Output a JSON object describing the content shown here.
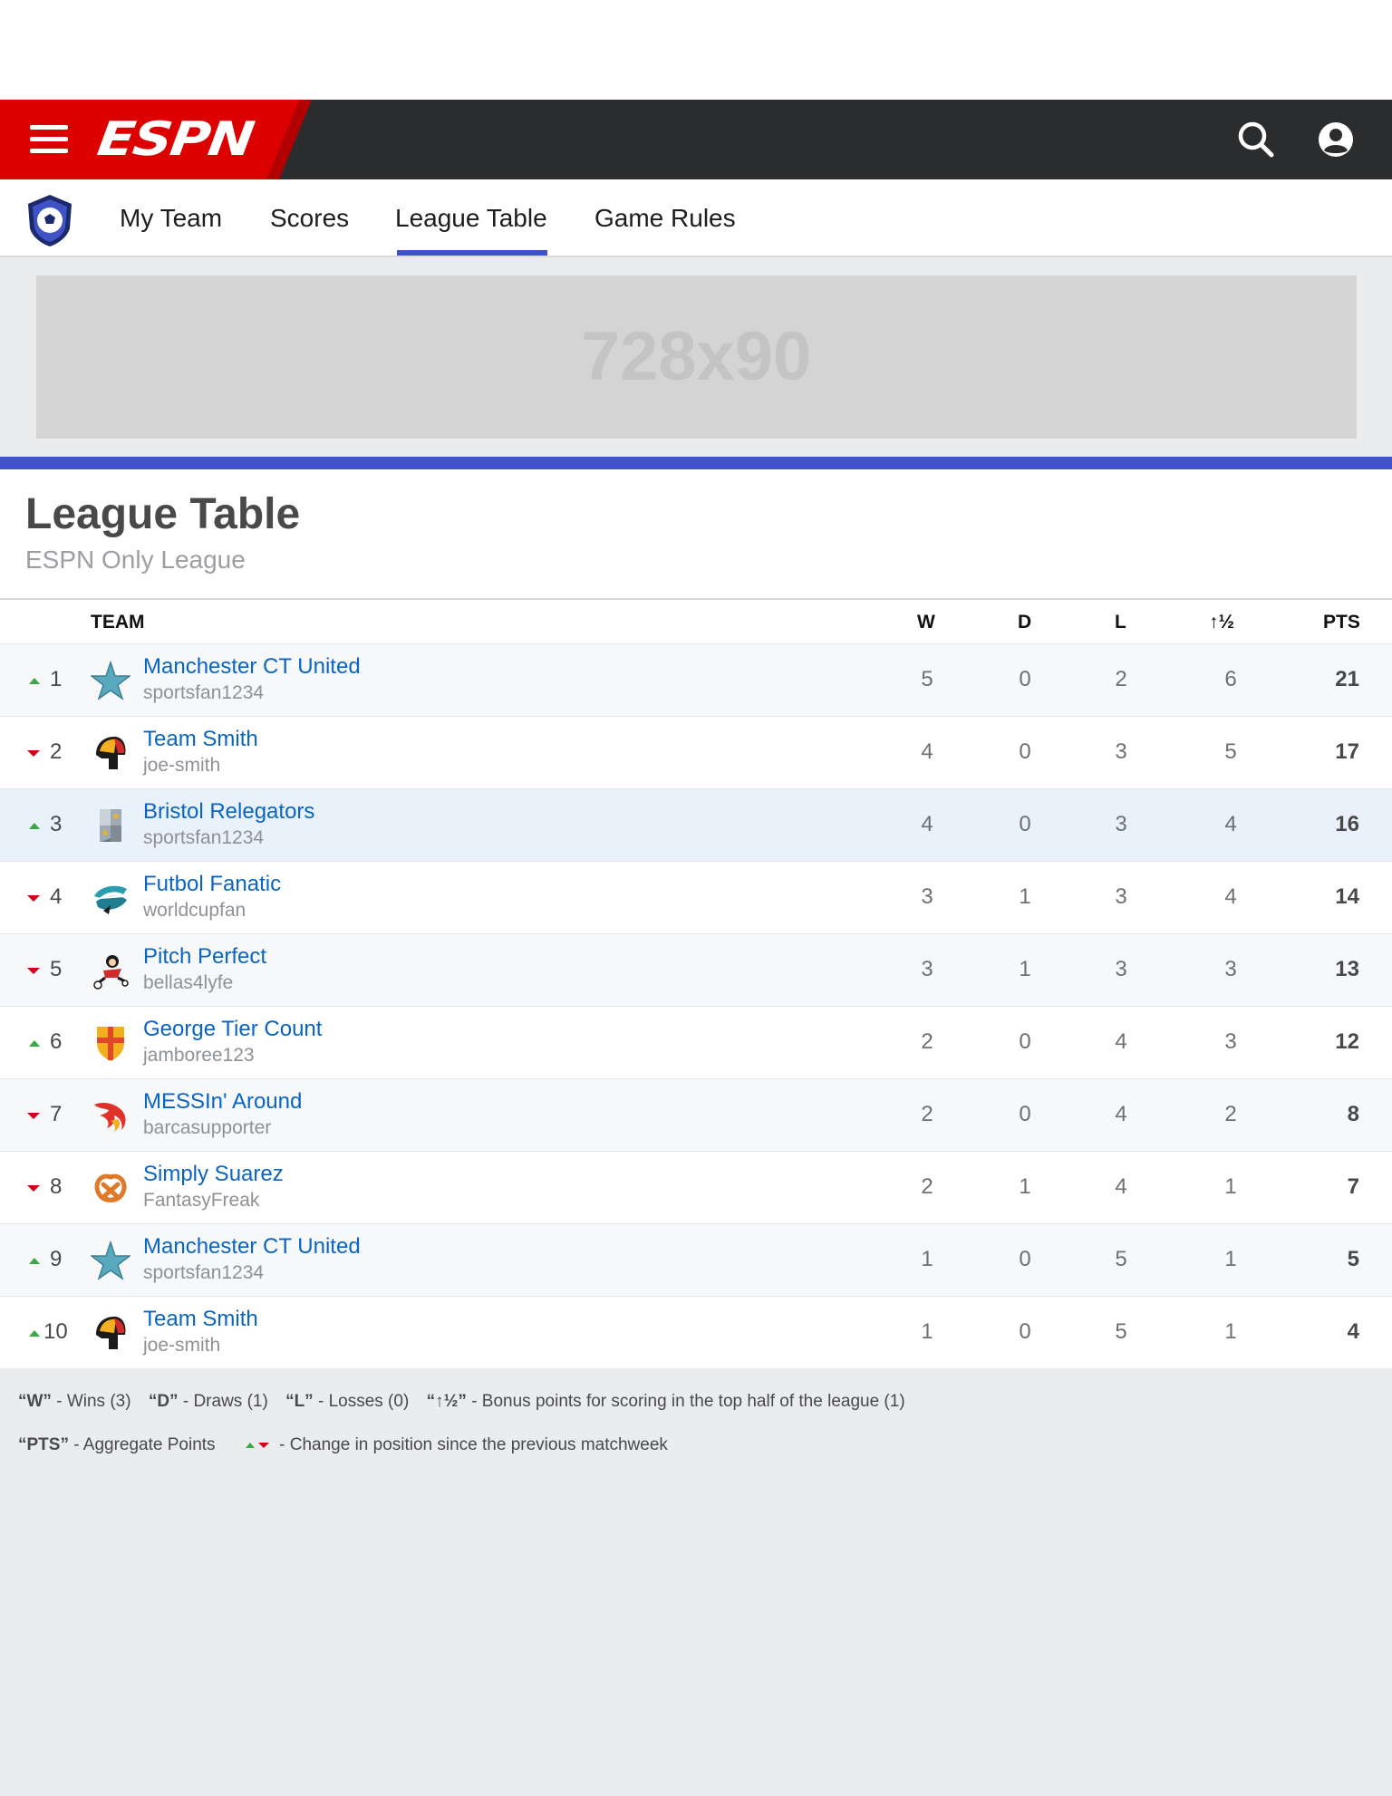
{
  "brand": {
    "name": "ESPN",
    "colors": {
      "red": "#dd0000",
      "dark_bar": "#2b2c2d",
      "accent_blue": "#3f53c7",
      "link_blue": "#0a64c1",
      "up_green": "#3da544",
      "down_red": "#d0021b"
    }
  },
  "header": {
    "menu_icon": "hamburger-menu-icon",
    "search_icon": "search-icon",
    "user_icon": "user-account-icon"
  },
  "subnav": {
    "badge_icon": "soccer-ball-shield-icon",
    "tabs": [
      {
        "label": "My Team",
        "active": false
      },
      {
        "label": "Scores",
        "active": false
      },
      {
        "label": "League Table",
        "active": true
      },
      {
        "label": "Game Rules",
        "active": false
      }
    ]
  },
  "ad": {
    "label": "728x90"
  },
  "page": {
    "title": "League Table",
    "subtitle": "ESPN Only League"
  },
  "table": {
    "columns": {
      "team": "TEAM",
      "w": "W",
      "d": "D",
      "l": "L",
      "bonus": "↑½",
      "pts": "PTS"
    },
    "rows": [
      {
        "rank": "1",
        "trend": "up",
        "logo": "star-logo-icon",
        "team": "Manchester CT United",
        "owner": "sportsfan1234",
        "w": "5",
        "d": "0",
        "l": "2",
        "bonus": "6",
        "pts": "21"
      },
      {
        "rank": "2",
        "trend": "down",
        "logo": "spartan-helmet-logo-icon",
        "team": "Team Smith",
        "owner": "joe-smith",
        "w": "4",
        "d": "0",
        "l": "3",
        "bonus": "5",
        "pts": "17"
      },
      {
        "rank": "3",
        "trend": "up",
        "logo": "crest-logo-icon",
        "team": "Bristol Relegators",
        "owner": "sportsfan1234",
        "w": "4",
        "d": "0",
        "l": "3",
        "bonus": "4",
        "pts": "16"
      },
      {
        "rank": "4",
        "trend": "down",
        "logo": "dolphin-logo-icon",
        "team": "Futbol Fanatic",
        "owner": "worldcupfan",
        "w": "3",
        "d": "1",
        "l": "3",
        "bonus": "4",
        "pts": "14"
      },
      {
        "rank": "5",
        "trend": "down",
        "logo": "cartoon-kicker-logo-icon",
        "team": "Pitch Perfect",
        "owner": "bellas4lyfe",
        "w": "3",
        "d": "1",
        "l": "3",
        "bonus": "3",
        "pts": "13"
      },
      {
        "rank": "6",
        "trend": "up",
        "logo": "cross-shield-logo-icon",
        "team": "George Tier Count",
        "owner": "jamboree123",
        "w": "2",
        "d": "0",
        "l": "4",
        "bonus": "3",
        "pts": "12"
      },
      {
        "rank": "7",
        "trend": "down",
        "logo": "phoenix-logo-icon",
        "team": "MESSIn' Around",
        "owner": "barcasupporter",
        "w": "2",
        "d": "0",
        "l": "4",
        "bonus": "2",
        "pts": "8"
      },
      {
        "rank": "8",
        "trend": "down",
        "logo": "pretzel-logo-icon",
        "team": "Simply Suarez",
        "owner": "FantasyFreak",
        "w": "2",
        "d": "1",
        "l": "4",
        "bonus": "1",
        "pts": "7"
      },
      {
        "rank": "9",
        "trend": "up",
        "logo": "star-logo-icon",
        "team": "Manchester CT United",
        "owner": "sportsfan1234",
        "w": "1",
        "d": "0",
        "l": "5",
        "bonus": "1",
        "pts": "5"
      },
      {
        "rank": "10",
        "trend": "up",
        "logo": "spartan-helmet-logo-icon",
        "team": "Team Smith",
        "owner": "joe-smith",
        "w": "1",
        "d": "0",
        "l": "5",
        "bonus": "1",
        "pts": "4"
      }
    ]
  },
  "legend": {
    "line1": [
      {
        "key": "“W”",
        "text": " - Wins (3)"
      },
      {
        "key": "“D”",
        "text": " - Draws (1)"
      },
      {
        "key": "“L”",
        "text": " - Losses (0)"
      },
      {
        "key": "“↑½”",
        "text": " - Bonus points for scoring in the top half of the league (1)"
      }
    ],
    "line2": [
      {
        "key": "“PTS”",
        "text": " - Aggregate Points"
      }
    ],
    "trend_text": " - Change in position since the previous matchweek"
  }
}
